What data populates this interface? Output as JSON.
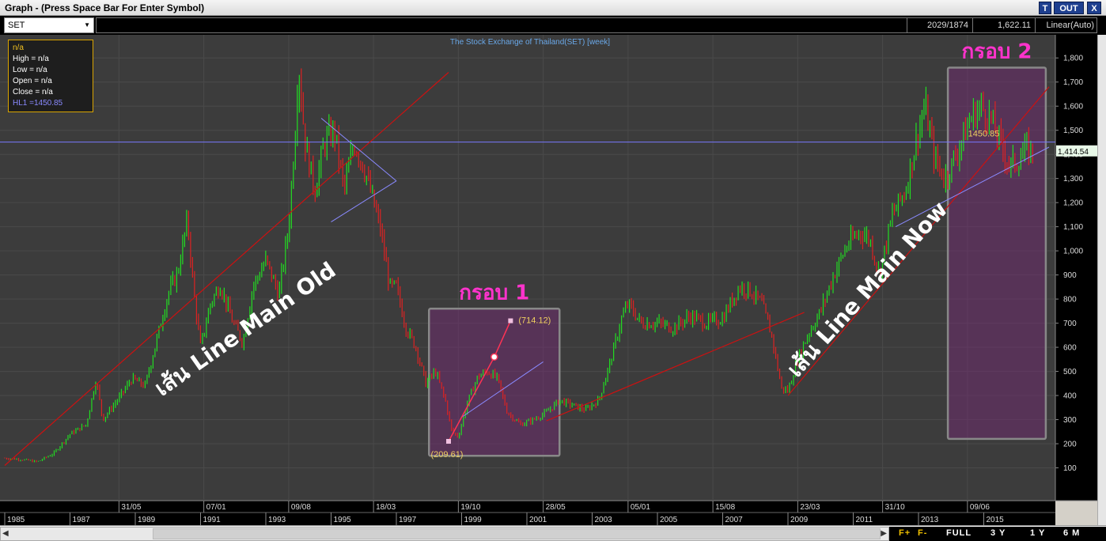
{
  "window": {
    "title": "Graph - (Press Space Bar For Enter Symbol)",
    "btn_t": "T",
    "btn_out": "OUT",
    "btn_x": "X"
  },
  "toolbar": {
    "symbol": "SET",
    "counter": "2029/1874",
    "value": "1,622.11",
    "scale": "Linear(Auto)"
  },
  "infobox": {
    "name": "n/a",
    "high": "High  = n/a",
    "low": "Low   = n/a",
    "open": "Open  = n/a",
    "close": "Close  = n/a",
    "hl": "HL1 =1450.85"
  },
  "bottom": {
    "left_arrow": "◀",
    "right_arrow": "▶",
    "f_plus": "F+",
    "f_minus": "F-",
    "full": "FULL",
    "y3": "3 Y",
    "y1": "1 Y",
    "m6": "6 M"
  },
  "colors": {
    "bg": "#3c3c3c",
    "up": "#22dd22",
    "down": "#dd2222",
    "trend": "#cc1111",
    "hline": "#7777ff",
    "box": "rgba(120,40,120,0.45)",
    "box_border": "#888888",
    "pink": "#ff33cc"
  },
  "chart_data": {
    "type": "candlestick",
    "title": "The Stock Exchange of Thailand(SET) [week]",
    "scale": "linear",
    "ylim": [
      0,
      1850
    ],
    "yticks": [
      100,
      200,
      300,
      400,
      500,
      600,
      700,
      800,
      900,
      1000,
      1100,
      1200,
      1300,
      1400,
      1500,
      1600,
      1700,
      1800
    ],
    "xlim": [
      1985,
      2017
    ],
    "x_year_labels": [
      "1985",
      "1987",
      "1989",
      "1991",
      "1993",
      "1995",
      "1997",
      "1999",
      "2001",
      "2003",
      "2005",
      "2007",
      "2009",
      "2011",
      "2013",
      "2015"
    ],
    "x_date_labels": [
      {
        "label": "31/05",
        "x": 1988.5
      },
      {
        "label": "07/01",
        "x": 1991.1
      },
      {
        "label": "09/08",
        "x": 1993.7
      },
      {
        "label": "18/03",
        "x": 1996.3
      },
      {
        "label": "19/10",
        "x": 1998.9
      },
      {
        "label": "28/05",
        "x": 2001.5
      },
      {
        "label": "05/01",
        "x": 2004.1
      },
      {
        "label": "15/08",
        "x": 2006.7
      },
      {
        "label": "23/03",
        "x": 2009.3
      },
      {
        "label": "31/10",
        "x": 2011.9
      },
      {
        "label": "09/06",
        "x": 2014.5
      }
    ],
    "last_price": "1,414.54",
    "last_value": 1414.54,
    "hline": {
      "value": 1450.85,
      "label": "1450.85"
    },
    "price_path": [
      [
        1985.0,
        140
      ],
      [
        1985.5,
        135
      ],
      [
        1986.0,
        125
      ],
      [
        1986.5,
        160
      ],
      [
        1987.0,
        240
      ],
      [
        1987.5,
        280
      ],
      [
        1987.8,
        470
      ],
      [
        1988.0,
        300
      ],
      [
        1988.5,
        390
      ],
      [
        1988.9,
        470
      ],
      [
        1989.3,
        440
      ],
      [
        1989.6,
        600
      ],
      [
        1990.0,
        820
      ],
      [
        1990.3,
        910
      ],
      [
        1990.6,
        1130
      ],
      [
        1990.8,
        820
      ],
      [
        1991.0,
        600
      ],
      [
        1991.3,
        780
      ],
      [
        1991.6,
        860
      ],
      [
        1992.0,
        700
      ],
      [
        1992.3,
        620
      ],
      [
        1992.6,
        850
      ],
      [
        1993.0,
        960
      ],
      [
        1993.4,
        820
      ],
      [
        1993.7,
        1100
      ],
      [
        1993.9,
        1500
      ],
      [
        1994.0,
        1790
      ],
      [
        1994.2,
        1450
      ],
      [
        1994.5,
        1250
      ],
      [
        1994.8,
        1450
      ],
      [
        1995.1,
        1500
      ],
      [
        1995.4,
        1250
      ],
      [
        1995.7,
        1450
      ],
      [
        1996.0,
        1350
      ],
      [
        1996.3,
        1200
      ],
      [
        1996.5,
        1100
      ],
      [
        1996.8,
        850
      ],
      [
        1997.0,
        850
      ],
      [
        1997.3,
        680
      ],
      [
        1997.6,
        600
      ],
      [
        1997.9,
        450
      ],
      [
        1998.2,
        500
      ],
      [
        1998.5,
        380
      ],
      [
        1998.7,
        250
      ],
      [
        1998.9,
        230
      ],
      [
        1999.2,
        380
      ],
      [
        1999.5,
        480
      ],
      [
        1999.8,
        500
      ],
      [
        2000.1,
        470
      ],
      [
        2000.4,
        330
      ],
      [
        2000.8,
        280
      ],
      [
        2001.2,
        300
      ],
      [
        2001.6,
        330
      ],
      [
        2002.0,
        380
      ],
      [
        2002.4,
        360
      ],
      [
        2002.8,
        340
      ],
      [
        2003.2,
        380
      ],
      [
        2003.6,
        560
      ],
      [
        2003.9,
        720
      ],
      [
        2004.1,
        780
      ],
      [
        2004.5,
        700
      ],
      [
        2005.0,
        700
      ],
      [
        2005.5,
        680
      ],
      [
        2006.0,
        730
      ],
      [
        2006.5,
        700
      ],
      [
        2007.0,
        720
      ],
      [
        2007.5,
        850
      ],
      [
        2007.8,
        840
      ],
      [
        2008.2,
        780
      ],
      [
        2008.5,
        650
      ],
      [
        2008.8,
        430
      ],
      [
        2009.0,
        420
      ],
      [
        2009.3,
        550
      ],
      [
        2009.6,
        650
      ],
      [
        2010.0,
        750
      ],
      [
        2010.4,
        900
      ],
      [
        2010.8,
        1020
      ],
      [
        2011.2,
        1080
      ],
      [
        2011.5,
        1050
      ],
      [
        2011.8,
        900
      ],
      [
        2012.2,
        1150
      ],
      [
        2012.6,
        1250
      ],
      [
        2013.0,
        1500
      ],
      [
        2013.2,
        1600
      ],
      [
        2013.5,
        1380
      ],
      [
        2013.8,
        1300
      ],
      [
        2014.0,
        1350
      ],
      [
        2014.3,
        1450
      ],
      [
        2014.6,
        1550
      ],
      [
        2014.9,
        1600
      ],
      [
        2015.2,
        1550
      ],
      [
        2015.5,
        1450
      ],
      [
        2015.8,
        1350
      ],
      [
        2016.0,
        1370
      ],
      [
        2016.3,
        1420
      ],
      [
        2016.5,
        1414.54
      ]
    ],
    "trendlines": [
      {
        "name": "old_main",
        "points": [
          [
            1985.0,
            110
          ],
          [
            1998.6,
            1740
          ]
        ],
        "color": "#cc1111",
        "width": 1.2
      },
      {
        "name": "now_main",
        "points": [
          [
            2009.0,
            400
          ],
          [
            2017.0,
            1680
          ]
        ],
        "color": "#cc1111",
        "width": 1.2
      },
      {
        "name": "2001_2009",
        "points": [
          [
            2001.6,
            295
          ],
          [
            2009.5,
            745
          ]
        ],
        "color": "#cc1111",
        "width": 1.2
      },
      {
        "name": "tri_top",
        "points": [
          [
            1994.7,
            1550
          ],
          [
            1997.0,
            1290
          ]
        ],
        "color": "#8a8aff",
        "width": 1
      },
      {
        "name": "tri_bottom",
        "points": [
          [
            1995.0,
            1120
          ],
          [
            1997.0,
            1290
          ]
        ],
        "color": "#8a8aff",
        "width": 1
      },
      {
        "name": "purple_2000",
        "points": [
          [
            1999.0,
            310
          ],
          [
            2001.5,
            540
          ]
        ],
        "color": "#8a8aff",
        "width": 1
      },
      {
        "name": "purple_2012",
        "points": [
          [
            2012.3,
            1100
          ],
          [
            2017.0,
            1430
          ]
        ],
        "color": "#8a8aff",
        "width": 1
      },
      {
        "name": "arrow",
        "points": [
          [
            1998.6,
            210
          ],
          [
            2000.0,
            560
          ],
          [
            2000.5,
            710
          ]
        ],
        "color": "#ff3355",
        "width": 1.5
      }
    ],
    "boxes": [
      {
        "x0": 1998.0,
        "x1": 2002.0,
        "y0": 150,
        "y1": 760,
        "label": "กรอบ 1"
      },
      {
        "x0": 2013.9,
        "x1": 2016.9,
        "y0": 220,
        "y1": 1760,
        "label": "กรอบ 2"
      }
    ],
    "annotations": [
      {
        "text": "(714.12)",
        "x": 2000.5,
        "y": 714.12
      },
      {
        "text": "(209.61)",
        "x": 1998.6,
        "y": 209.61
      }
    ],
    "text_overlays": [
      {
        "text": "เส้น Line Main Old",
        "x": 1992.5,
        "y": 650,
        "angle": -35
      },
      {
        "text": "เส้น Line Main Now",
        "x": 2011.6,
        "y": 820,
        "angle": -48
      }
    ]
  }
}
